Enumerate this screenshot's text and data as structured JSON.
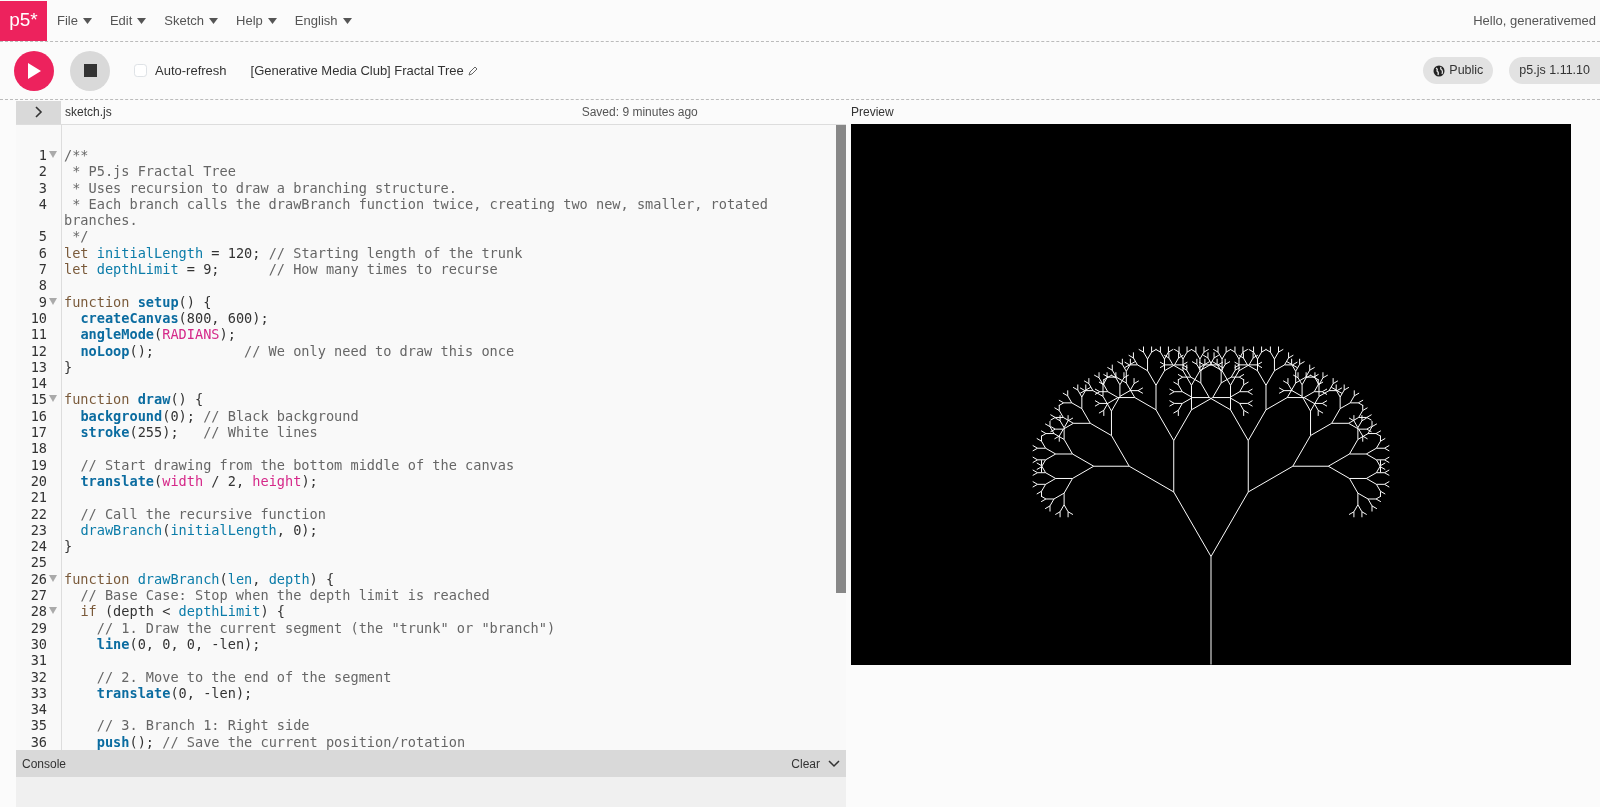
{
  "nav": {
    "logo": "p5*",
    "menus": [
      {
        "label": "File"
      },
      {
        "label": "Edit"
      },
      {
        "label": "Sketch"
      },
      {
        "label": "Help"
      },
      {
        "label": "English"
      }
    ],
    "greeting": "Hello, generativemed"
  },
  "toolbar": {
    "auto_refresh": {
      "label": "Auto-refresh",
      "checked": false
    },
    "sketch_title": "[Generative Media Club] Fractal Tree",
    "visibility": "Public",
    "version": "p5.js 1.11.10"
  },
  "editor": {
    "file_name": "sketch.js",
    "saved": "Saved: 9 minutes ago",
    "lines": [
      {
        "number": "1",
        "fold_marker": true,
        "tokens": [
          {
            "kind": "comment",
            "text": "/**"
          }
        ]
      },
      {
        "number": "2",
        "fold_marker": false,
        "tokens": [
          {
            "kind": "comment",
            "text": " * P5.js Fractal Tree"
          }
        ]
      },
      {
        "number": "3",
        "fold_marker": false,
        "tokens": [
          {
            "kind": "comment",
            "text": " * Uses recursion to draw a branching structure."
          }
        ]
      },
      {
        "number": "4",
        "fold_marker": false,
        "tokens": [
          {
            "kind": "comment",
            "text": " * Each branch calls the drawBranch function twice, creating two new, smaller, rotated branches."
          }
        ]
      },
      {
        "number": "5",
        "fold_marker": false,
        "tokens": [
          {
            "kind": "comment",
            "text": " */"
          }
        ]
      },
      {
        "number": "6",
        "fold_marker": false,
        "tokens": [
          {
            "kind": "keyword",
            "text": "let "
          },
          {
            "kind": "variable",
            "text": "initialLength"
          },
          {
            "kind": "plain",
            "text": " = 120; "
          },
          {
            "kind": "comment",
            "text": "// Starting length of the trunk"
          }
        ]
      },
      {
        "number": "7",
        "fold_marker": false,
        "tokens": [
          {
            "kind": "keyword",
            "text": "let "
          },
          {
            "kind": "variable",
            "text": "depthLimit"
          },
          {
            "kind": "plain",
            "text": " = 9;      "
          },
          {
            "kind": "comment",
            "text": "// How many times to recurse"
          }
        ]
      },
      {
        "number": "8",
        "fold_marker": false
      },
      {
        "number": "9",
        "fold_marker": true,
        "tokens": [
          {
            "kind": "keyword",
            "text": "function "
          },
          {
            "kind": "builtin",
            "text": "setup"
          },
          {
            "kind": "plain",
            "text": "() {"
          }
        ]
      },
      {
        "number": "10",
        "fold_marker": false,
        "tokens": [
          {
            "kind": "builtin",
            "text": "  createCanvas"
          },
          {
            "kind": "plain",
            "text": "(800, 600);"
          }
        ]
      },
      {
        "number": "11",
        "fold_marker": false,
        "tokens": [
          {
            "kind": "builtin",
            "text": "  angleMode"
          },
          {
            "kind": "plain",
            "text": "("
          },
          {
            "kind": "constant",
            "text": "RADIANS"
          },
          {
            "kind": "plain",
            "text": ");"
          }
        ]
      },
      {
        "number": "12",
        "fold_marker": false,
        "tokens": [
          {
            "kind": "builtin",
            "text": "  noLoop"
          },
          {
            "kind": "plain",
            "text": "();           "
          },
          {
            "kind": "comment",
            "text": "// We only need to draw this once"
          }
        ]
      },
      {
        "number": "13",
        "fold_marker": false,
        "tokens": [
          {
            "kind": "plain",
            "text": "}"
          }
        ]
      },
      {
        "number": "14",
        "fold_marker": false
      },
      {
        "number": "15",
        "fold_marker": true,
        "tokens": [
          {
            "kind": "keyword",
            "text": "function "
          },
          {
            "kind": "builtin",
            "text": "draw"
          },
          {
            "kind": "plain",
            "text": "() {"
          }
        ]
      },
      {
        "number": "16",
        "fold_marker": false,
        "tokens": [
          {
            "kind": "builtin",
            "text": "  background"
          },
          {
            "kind": "plain",
            "text": "(0); "
          },
          {
            "kind": "comment",
            "text": "// Black background"
          }
        ]
      },
      {
        "number": "17",
        "fold_marker": false,
        "tokens": [
          {
            "kind": "builtin",
            "text": "  stroke"
          },
          {
            "kind": "plain",
            "text": "(255);   "
          },
          {
            "kind": "comment",
            "text": "// White lines"
          }
        ]
      },
      {
        "number": "18",
        "fold_marker": false
      },
      {
        "number": "19",
        "fold_marker": false,
        "tokens": [
          {
            "kind": "comment",
            "text": "  // Start drawing from the bottom middle of the canvas"
          }
        ]
      },
      {
        "number": "20",
        "fold_marker": false,
        "tokens": [
          {
            "kind": "builtin",
            "text": "  translate"
          },
          {
            "kind": "plain",
            "text": "("
          },
          {
            "kind": "constant",
            "text": "width"
          },
          {
            "kind": "plain",
            "text": " / 2, "
          },
          {
            "kind": "constant",
            "text": "height"
          },
          {
            "kind": "plain",
            "text": ");"
          }
        ]
      },
      {
        "number": "21",
        "fold_marker": false
      },
      {
        "number": "22",
        "fold_marker": false,
        "tokens": [
          {
            "kind": "comment",
            "text": "  // Call the recursive function"
          }
        ]
      },
      {
        "number": "23",
        "fold_marker": false,
        "tokens": [
          {
            "kind": "variable",
            "text": "  drawBranch"
          },
          {
            "kind": "plain",
            "text": "("
          },
          {
            "kind": "variable",
            "text": "initialLength"
          },
          {
            "kind": "plain",
            "text": ", 0);"
          }
        ]
      },
      {
        "number": "24",
        "fold_marker": false,
        "tokens": [
          {
            "kind": "plain",
            "text": "}"
          }
        ]
      },
      {
        "number": "25",
        "fold_marker": false
      },
      {
        "number": "26",
        "fold_marker": true,
        "tokens": [
          {
            "kind": "keyword",
            "text": "function "
          },
          {
            "kind": "variable",
            "text": "drawBranch"
          },
          {
            "kind": "plain",
            "text": "("
          },
          {
            "kind": "variable",
            "text": "len"
          },
          {
            "kind": "plain",
            "text": ", "
          },
          {
            "kind": "variable",
            "text": "depth"
          },
          {
            "kind": "plain",
            "text": ") {"
          }
        ]
      },
      {
        "number": "27",
        "fold_marker": false,
        "tokens": [
          {
            "kind": "comment",
            "text": "  // Base Case: Stop when the depth limit is reached"
          }
        ]
      },
      {
        "number": "28",
        "fold_marker": true,
        "tokens": [
          {
            "kind": "keyword",
            "text": "  if"
          },
          {
            "kind": "plain",
            "text": " (depth < "
          },
          {
            "kind": "variable",
            "text": "depthLimit"
          },
          {
            "kind": "plain",
            "text": ") {"
          }
        ]
      },
      {
        "number": "29",
        "fold_marker": false,
        "tokens": [
          {
            "kind": "comment",
            "text": "    // 1. Draw the current segment (the \"trunk\" or \"branch\")"
          }
        ]
      },
      {
        "number": "30",
        "fold_marker": false,
        "tokens": [
          {
            "kind": "builtin",
            "text": "    line"
          },
          {
            "kind": "plain",
            "text": "(0, 0, 0, -len);"
          }
        ]
      },
      {
        "number": "31",
        "fold_marker": false
      },
      {
        "number": "32",
        "fold_marker": false,
        "tokens": [
          {
            "kind": "comment",
            "text": "    // 2. Move to the end of the segment"
          }
        ]
      },
      {
        "number": "33",
        "fold_marker": false,
        "tokens": [
          {
            "kind": "builtin",
            "text": "    translate"
          },
          {
            "kind": "plain",
            "text": "(0, -len);"
          }
        ]
      },
      {
        "number": "34",
        "fold_marker": false
      },
      {
        "number": "35",
        "fold_marker": false,
        "tokens": [
          {
            "kind": "comment",
            "text": "    // 3. Branch 1: Right side"
          }
        ]
      },
      {
        "number": "36",
        "fold_marker": false,
        "tokens": [
          {
            "kind": "builtin",
            "text": "    push"
          },
          {
            "kind": "plain",
            "text": "(); "
          },
          {
            "kind": "comment",
            "text": "// Save the current position/rotation"
          }
        ]
      }
    ]
  },
  "preview": {
    "label": "Preview"
  },
  "console": {
    "label": "Console",
    "clear": "Clear"
  }
}
